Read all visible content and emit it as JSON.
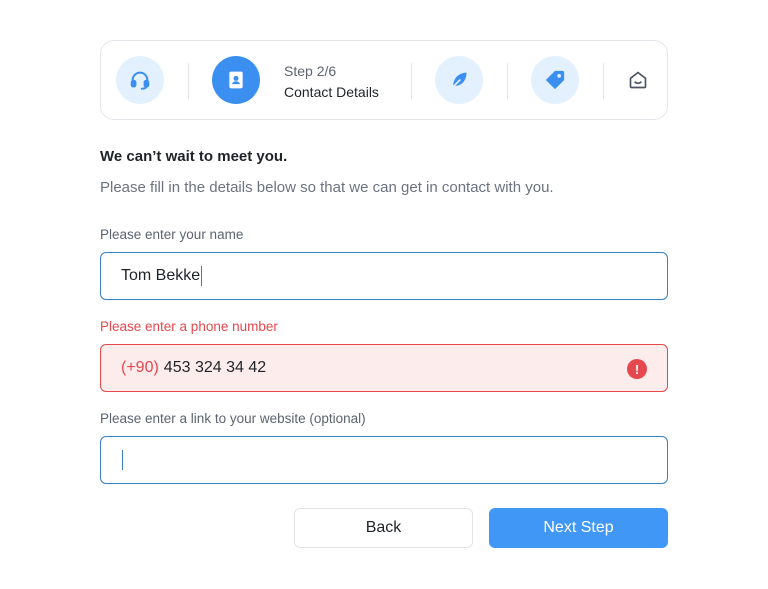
{
  "stepper": {
    "step_counter": "Step 2/6",
    "current_title": "Contact Details",
    "steps": [
      {
        "icon": "headset-icon"
      },
      {
        "icon": "contact-book-icon"
      },
      {
        "icon": "leaf-icon"
      },
      {
        "icon": "tag-icon"
      },
      {
        "icon": "home-icon"
      }
    ],
    "accent_color": "#3b8ff0",
    "inactive_bg": "#e3f0fd"
  },
  "header": {
    "title": "We can’t wait to meet you.",
    "subtitle": "Please fill in the details below so that we can get in contact with you."
  },
  "form": {
    "name": {
      "label": "Please enter your name",
      "value": "Tom Bekke"
    },
    "phone": {
      "label": "Please enter a phone number",
      "prefix": "(+90)",
      "value": "453 324 34 42",
      "error_color": "#e5484d"
    },
    "website": {
      "label": "Please enter a link to your website (optional)",
      "value": ""
    }
  },
  "buttons": {
    "back": "Back",
    "next": "Next Step"
  }
}
